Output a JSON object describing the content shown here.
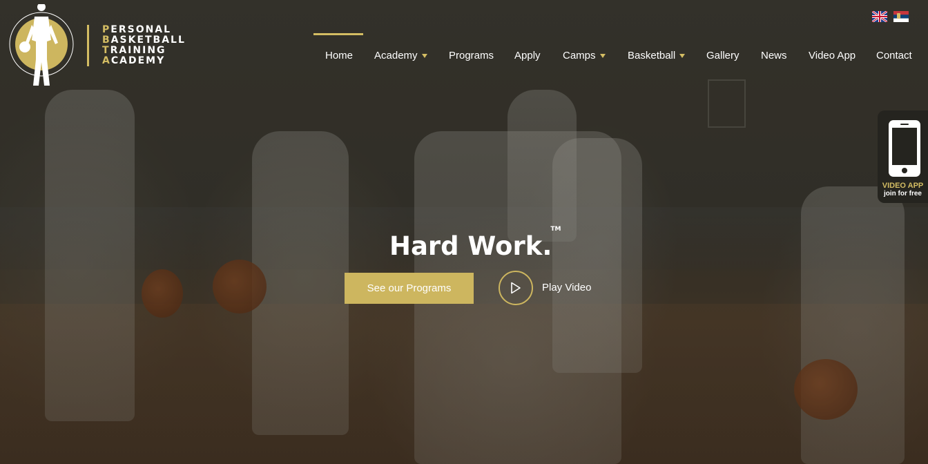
{
  "brand": {
    "logo_ring_text": "PERSONAL BASKETBALL TRAINING ACADEMY",
    "lines": [
      {
        "initial": "P",
        "rest": "ERSONAL"
      },
      {
        "initial": "B",
        "rest": "ASKETBALL"
      },
      {
        "initial": "T",
        "rest": "RAINING"
      },
      {
        "initial": "A",
        "rest": "CADEMY"
      }
    ]
  },
  "nav": {
    "items": [
      {
        "label": "Home",
        "dropdown": false,
        "active": true
      },
      {
        "label": "Academy",
        "dropdown": true
      },
      {
        "label": "Programs",
        "dropdown": false
      },
      {
        "label": "Apply",
        "dropdown": false
      },
      {
        "label": "Camps",
        "dropdown": true
      },
      {
        "label": "Basketball",
        "dropdown": true
      },
      {
        "label": "Gallery",
        "dropdown": false
      },
      {
        "label": "News",
        "dropdown": false
      },
      {
        "label": "Video App",
        "dropdown": false
      },
      {
        "label": "Contact",
        "dropdown": false
      }
    ]
  },
  "languages": [
    "uk-flag-icon",
    "serbia-flag-icon"
  ],
  "app_widget": {
    "icon": "smartphone-icon",
    "title": "VIDEO APP",
    "subtitle": "join for free"
  },
  "hero": {
    "title": "Hard Work.",
    "trademark": "TM",
    "cta_label": "See our Programs",
    "play_label": "Play Video",
    "play_icon": "play-icon"
  },
  "colors": {
    "accent": "#cdb65f",
    "text": "#ffffff",
    "overlay": "#2f2d27"
  }
}
